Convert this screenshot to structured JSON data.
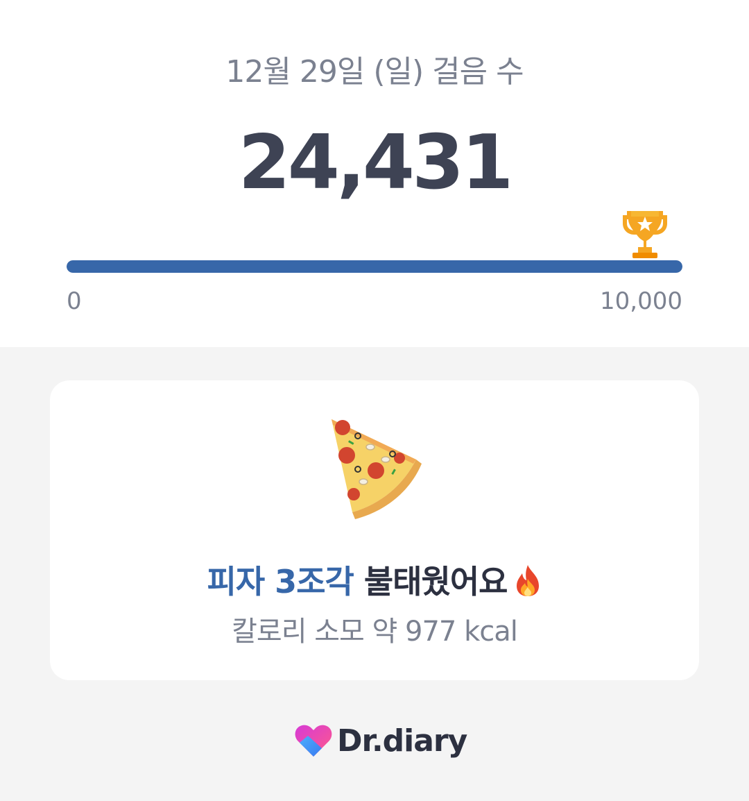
{
  "header": {
    "date_title": "12월 29일 (일) 걸음 수",
    "step_count": "24,431"
  },
  "progress": {
    "value": 24431,
    "goal": 10000,
    "fill_fraction": 1.0,
    "min_label": "0",
    "max_label": "10,000",
    "goal_icon": "trophy-icon"
  },
  "card": {
    "food_icon": "pizza-icon",
    "burn_highlight": "피자 3조각",
    "burn_text": " 불태웠어요",
    "burn_icon": "fire-icon",
    "calorie_text": "칼로리 소모 약 977 kcal"
  },
  "brand": {
    "logo_icon": "heart-logo-icon",
    "name": "Dr.diary"
  },
  "colors": {
    "accent": "#3767a9",
    "text_dark": "#3e4354",
    "text_muted": "#7b8190",
    "trophy": "#f5a623"
  }
}
